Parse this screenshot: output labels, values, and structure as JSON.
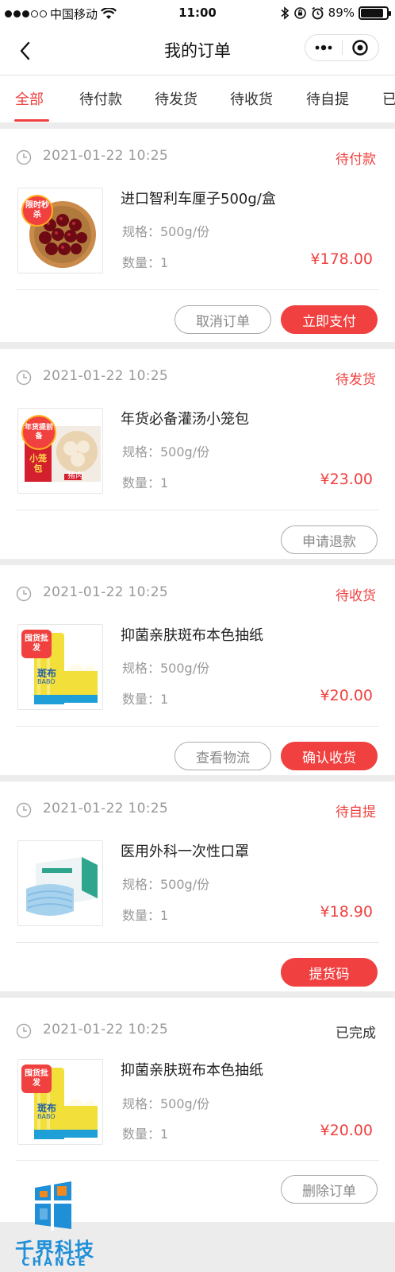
{
  "status_bar": {
    "carrier": "中国移动",
    "time": "11:00",
    "battery": "89%",
    "battery_level": 0.89
  },
  "nav": {
    "title": "我的订单"
  },
  "tabs": [
    {
      "label": "全部",
      "active": true
    },
    {
      "label": "待付款",
      "active": false
    },
    {
      "label": "待发货",
      "active": false
    },
    {
      "label": "待收货",
      "active": false
    },
    {
      "label": "待自提",
      "active": false
    },
    {
      "label": "已",
      "active": false
    }
  ],
  "orders": [
    {
      "time": "2021-01-22  10:25",
      "status": "待付款",
      "product": "进口智利车厘子500g/盒",
      "spec": "规格：500g/份",
      "qty": "数量：1",
      "price": "¥178.00",
      "badge": "限时秒杀",
      "image_icon": "cherries-icon",
      "buttons": [
        "取消订单",
        "立即支付"
      ]
    },
    {
      "time": "2021-01-22  10:25",
      "status": "待发货",
      "product": "年货必备灌汤小笼包",
      "spec": "规格：500g/份",
      "qty": "数量：1",
      "price": "¥23.00",
      "badge": "年货提前备",
      "image_icon": "dumpling-package-icon",
      "buttons": [
        "申请退款"
      ]
    },
    {
      "time": "2021-01-22  10:25",
      "status": "待收货",
      "product": "抑菌亲肤斑布本色抽纸",
      "spec": "规格：500g/份",
      "qty": "数量：1",
      "price": "¥20.00",
      "badge": "囤货批发",
      "image_icon": "tissue-package-icon",
      "buttons": [
        "查看物流",
        "确认收货"
      ]
    },
    {
      "time": "2021-01-22  10:25",
      "status": "待自提",
      "product": "医用外科一次性口罩",
      "spec": "规格：500g/份",
      "qty": "数量：1",
      "price": "¥18.90",
      "badge": "",
      "image_icon": "face-mask-box-icon",
      "buttons": [
        "提货码"
      ]
    },
    {
      "time": "2021-01-22  10:25",
      "status": "已完成",
      "product": "抑菌亲肤斑布本色抽纸",
      "spec": "规格：500g/份",
      "qty": "数量：1",
      "price": "¥20.00",
      "badge": "囤货批发",
      "image_icon": "tissue-package-icon",
      "buttons": [
        "删除订单"
      ]
    }
  ],
  "product_image_text": {
    "tissue_brand": "斑布",
    "tissue_brand_en": "BABO",
    "dumpling_label": "小笼包",
    "dumpling_sub": "猪肉"
  },
  "watermark": {
    "name": "千界科技",
    "sub": "CHANGE"
  },
  "colors": {
    "accent": "#f0403f",
    "muted": "#999999",
    "background": "#ececec"
  }
}
